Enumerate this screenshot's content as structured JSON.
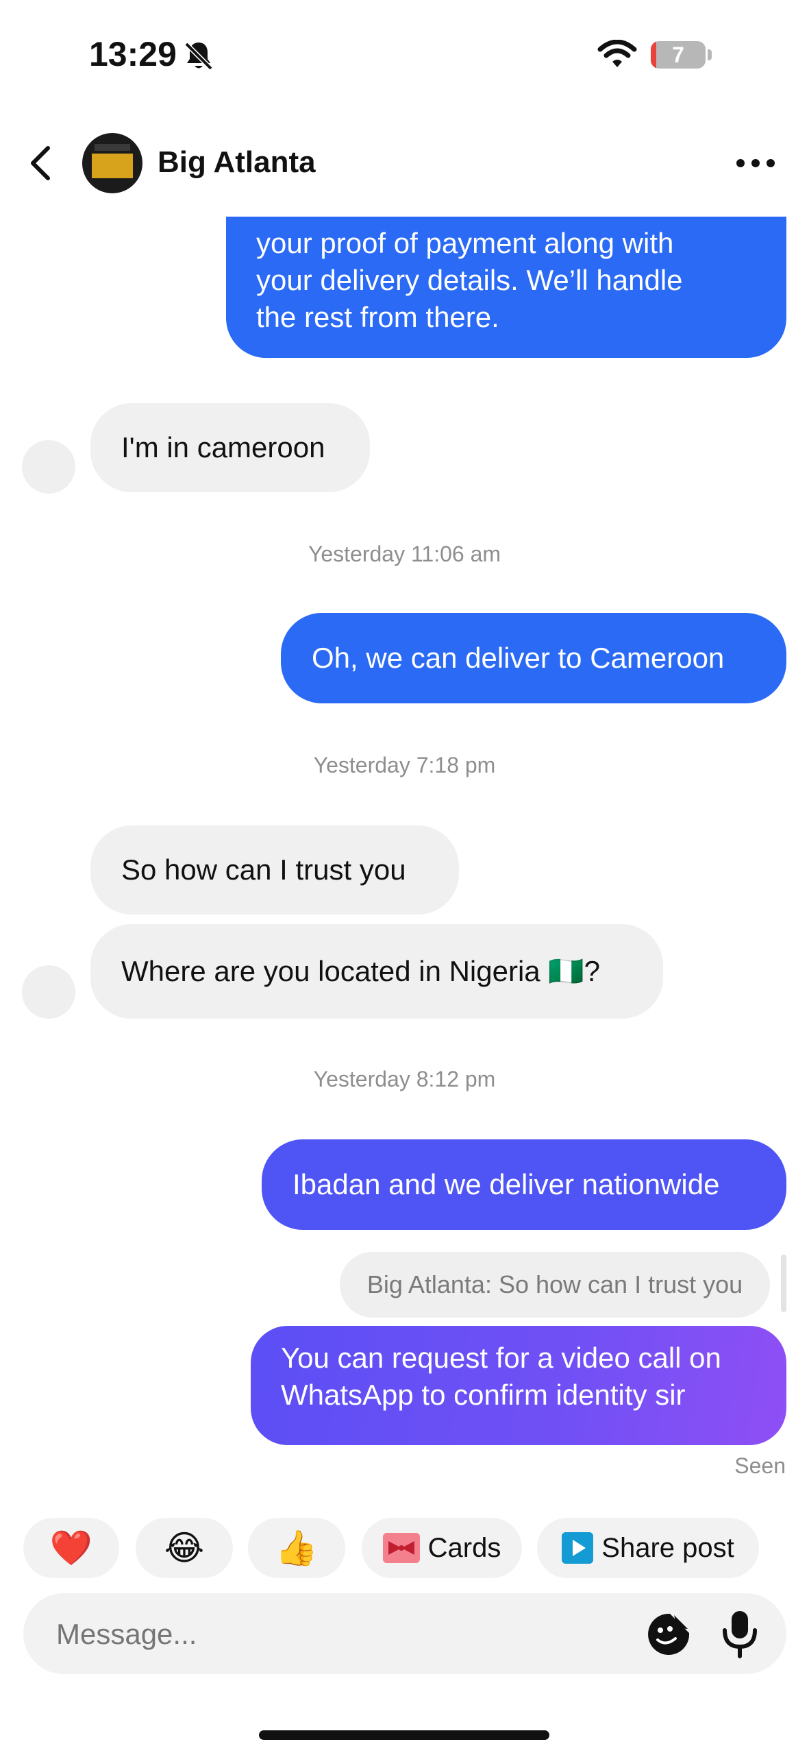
{
  "status_bar": {
    "time": "13:29",
    "battery_level": "7"
  },
  "header": {
    "contact_name": "Big Atlanta"
  },
  "messages": [
    {
      "type": "sent",
      "lines": [
        "your proof of payment along with",
        "your delivery details. We’ll handle",
        "the rest from there."
      ]
    },
    {
      "type": "received",
      "text": "I'm in cameroon"
    },
    {
      "type": "timestamp",
      "text": "Yesterday 11:06 am"
    },
    {
      "type": "sent",
      "text": "Oh, we can deliver to Cameroon"
    },
    {
      "type": "timestamp",
      "text": "Yesterday 7:18 pm"
    },
    {
      "type": "received",
      "text": "So how can I trust you"
    },
    {
      "type": "received",
      "text": "Where are you located in Nigeria 🇳🇬?"
    },
    {
      "type": "timestamp",
      "text": "Yesterday 8:12 pm"
    },
    {
      "type": "sent",
      "text": "Ibadan and we deliver nationwide"
    },
    {
      "type": "reply_preview",
      "text": "Big Atlanta: So how can I trust you"
    },
    {
      "type": "sent",
      "lines": [
        "You can request for a video call on",
        "WhatsApp to confirm identity sir"
      ]
    },
    {
      "type": "status",
      "text": "Seen"
    }
  ],
  "quick_actions": [
    {
      "label": "❤️",
      "icon": "heart-icon"
    },
    {
      "label": "😂",
      "icon": "laughing-emoji-icon"
    },
    {
      "label": "👍",
      "icon": "thumbs-up-icon"
    },
    {
      "label": "Cards",
      "icon": "gift-card-icon"
    },
    {
      "label": "Share post",
      "icon": "play-icon"
    }
  ],
  "composer": {
    "placeholder": "Message..."
  },
  "colors": {
    "sent_blue": "#2a6af5",
    "sent_indigo": "#5b4ff5",
    "sent_purple": "#8f4ff5",
    "received_bg": "#f0f0f0"
  }
}
